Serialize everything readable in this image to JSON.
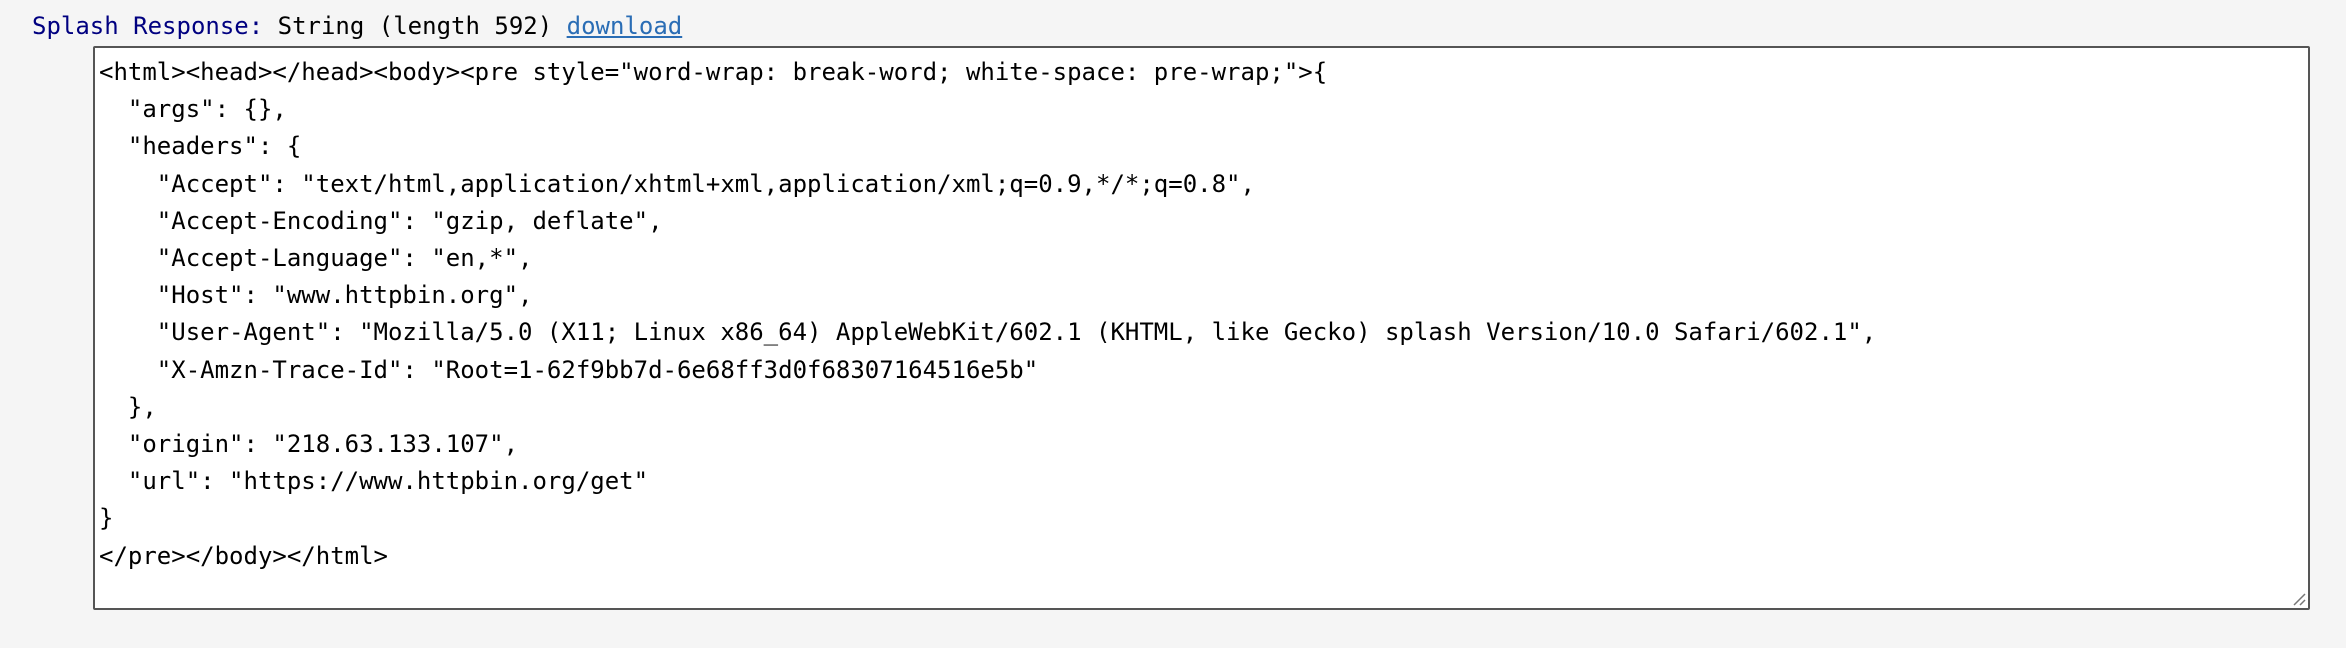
{
  "header": {
    "label": "Splash Response:",
    "type_text": " String (length 592) ",
    "download_label": "download"
  },
  "response": {
    "text": "<html><head></head><body><pre style=\"word-wrap: break-word; white-space: pre-wrap;\">{\n  \"args\": {},\n  \"headers\": {\n    \"Accept\": \"text/html,application/xhtml+xml,application/xml;q=0.9,*/*;q=0.8\",\n    \"Accept-Encoding\": \"gzip, deflate\",\n    \"Accept-Language\": \"en,*\",\n    \"Host\": \"www.httpbin.org\",\n    \"User-Agent\": \"Mozilla/5.0 (X11; Linux x86_64) AppleWebKit/602.1 (KHTML, like Gecko) splash Version/10.0 Safari/602.1\",\n    \"X-Amzn-Trace-Id\": \"Root=1-62f9bb7d-6e68ff3d0f68307164516e5b\"\n  },\n  \"origin\": \"218.63.133.107\",\n  \"url\": \"https://www.httpbin.org/get\"\n}\n</pre></body></html>"
  },
  "colors": {
    "label": "#000080",
    "link": "#2a6db5",
    "background": "#f5f5f5",
    "box_border": "#555555"
  },
  "icons": {
    "resize": "resize-grip-icon"
  }
}
